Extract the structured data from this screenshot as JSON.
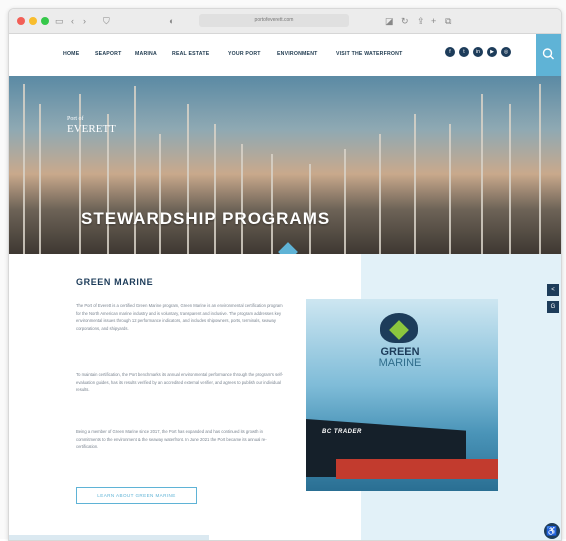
{
  "browser": {
    "url": "portofeverett.com"
  },
  "nav": {
    "items": [
      "HOME",
      "SEAPORT",
      "MARINA",
      "REAL ESTATE",
      "YOUR PORT",
      "ENVIRONMENT",
      "VISIT THE WATERFRONT"
    ],
    "social_icons": [
      "facebook-icon",
      "twitter-icon",
      "linkedin-icon",
      "youtube-icon",
      "instagram-icon"
    ],
    "search_icon": "search-icon"
  },
  "hero": {
    "logo_top": "Port of",
    "logo_main": "EVERETT",
    "title": "STEWARDSHIP PROGRAMS"
  },
  "section": {
    "title": "GREEN MARINE",
    "paragraphs": [
      "The Port of Everett is a certified Green Marine program, Green Marine is an environmental certification program for the North American marine industry and is voluntary, transparent and inclusive. The program addresses key environmental issues through 12 performance indicators, and includes shipowners, ports, terminals, seaway corporations, and shipyards.",
      "To maintain certification, the Port benchmarks its annual environmental performance through the program's self-evaluation guides, has its results verified by an accredited external verifier, and agrees to publish our individual results.",
      "Being a member of Green Marine since 2017, the Port has expanded and has continued its growth in commitments to the environment & the seaway waterfront. In June 2021 the Port became its annual re-certification."
    ],
    "cta_label": "LEARN ABOUT GREEN MARINE"
  },
  "photo": {
    "ship_name": "BC TRADER",
    "logo_line1": "GREEN",
    "logo_line2": "MARINE"
  },
  "colors": {
    "navy": "#1d3c5a",
    "accent": "#5fb3d6",
    "panel": "#e2f1f8"
  }
}
